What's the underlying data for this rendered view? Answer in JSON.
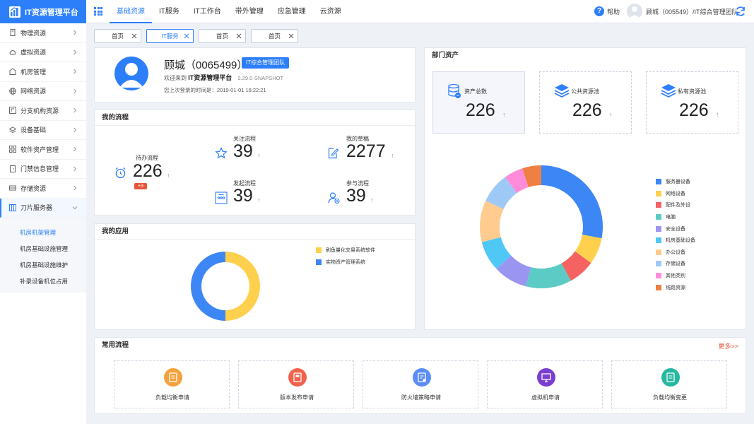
{
  "app": {
    "title": "IT资源管理平台"
  },
  "topnav": {
    "items": [
      "基础资源",
      "IT服务",
      "IT工作台",
      "带外管理",
      "应急管理",
      "云资源"
    ],
    "help": "帮助",
    "user": "顾城（005549）/IT综合管理团队"
  },
  "sidebar": {
    "items": [
      "物理资源",
      "虚拟资源",
      "机房管理",
      "网络资源",
      "分支机构资源",
      "设备基础",
      "软件资产管理",
      "门禁信息管理",
      "存储资源",
      "刀片服务器"
    ],
    "sub": [
      "机房机架管理",
      "机房基础设施管理",
      "机房基础设施维护",
      "补录设备机位占用"
    ]
  },
  "tabs": [
    "首页",
    "IT服务",
    "首页",
    "首页"
  ],
  "profile": {
    "name": "顾城（0065499）",
    "team": "IT综合管理团队",
    "welcome_prefix": "欢迎来到",
    "platform": "IT资源管理平台",
    "version": "2.29.0-SNAPSHOT",
    "last_login": "您上次登录的时间是：2019-01-01  16:22:21"
  },
  "flows": {
    "title": "我的流程",
    "todo": {
      "label": "待办流程",
      "value": "226",
      "badge": "+3"
    },
    "follow": {
      "label": "关注流程",
      "value": "39"
    },
    "draft": {
      "label": "我的草稿",
      "value": "2277"
    },
    "started": {
      "label": "发起流程",
      "value": "39"
    },
    "joined": {
      "label": "参与流程",
      "value": "39"
    },
    "arrow": "↑"
  },
  "apps": {
    "title": "我的应用",
    "legend": [
      "刷鱼量化交易系统软件",
      "实物资产管理系统"
    ]
  },
  "dept": {
    "title": "部门资产",
    "boxes": [
      {
        "label": "资产总数",
        "value": "226"
      },
      {
        "label": "公共资源池",
        "value": "226"
      },
      {
        "label": "私有资源池",
        "value": "226"
      }
    ]
  },
  "common": {
    "title": "常用流程",
    "more": "更多>>",
    "items": [
      "负载均衡申请",
      "版本发布申请",
      "防火墙策略申请",
      "虚拟机申请",
      "负载均衡变更"
    ]
  },
  "chart_data": [
    {
      "type": "pie",
      "categories": [
        "刷鱼量化交易系统软件",
        "实物资产管理系统"
      ],
      "values": [
        50,
        50
      ],
      "colors": [
        "#ffd04d",
        "#3d86f5"
      ],
      "legend": "right"
    },
    {
      "type": "pie",
      "categories": [
        "服务器设备",
        "网络设备",
        "配件及外设",
        "电脑",
        "安全设备",
        "机房基础设备",
        "办公设备",
        "存储设备",
        "其他类别",
        "线路资源"
      ],
      "values": [
        28,
        7,
        7,
        12,
        9,
        8,
        11,
        8,
        5,
        5
      ],
      "colors": [
        "#3d86f5",
        "#ffd04d",
        "#f56262",
        "#5ccbc5",
        "#9b95f2",
        "#50c8f5",
        "#ffcb8f",
        "#9ec9f7",
        "#ff8cd9",
        "#f07f44"
      ],
      "legend": "right"
    }
  ]
}
